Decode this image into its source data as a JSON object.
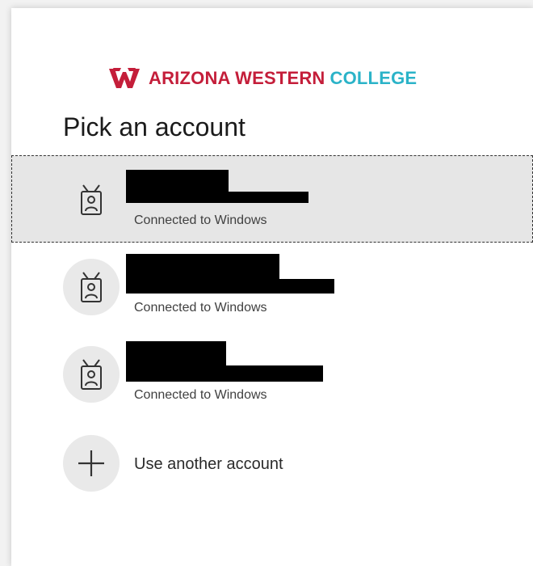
{
  "brand": {
    "logo_mark_name": "awc-logo-mark",
    "name_primary": "ARIZONA WESTERN",
    "name_secondary": "COLLEGE",
    "colors": {
      "primary": "#c41e3a",
      "secondary": "#2bb3c8"
    }
  },
  "page": {
    "title": "Pick an account"
  },
  "accounts": [
    {
      "status": "Connected to Windows",
      "selected": true,
      "icon": "badge-person-icon"
    },
    {
      "status": "Connected to Windows",
      "selected": false,
      "icon": "badge-person-icon"
    },
    {
      "status": "Connected to Windows",
      "selected": false,
      "icon": "badge-person-icon"
    }
  ],
  "actions": {
    "use_another_account": "Use another account",
    "use_another_account_icon": "plus-icon"
  }
}
